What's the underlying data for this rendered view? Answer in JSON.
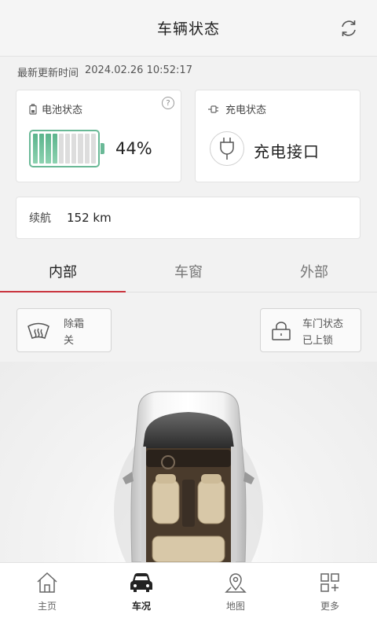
{
  "header": {
    "title": "车辆状态"
  },
  "update": {
    "label": "最新更新时间",
    "time": "2024.02.26 10:52:17"
  },
  "battery": {
    "title": "电池状态",
    "help": "?",
    "percent_text": "44%",
    "level": 0.44
  },
  "charge": {
    "title": "充电状态",
    "status": "充电接口"
  },
  "range": {
    "label": "续航",
    "value": "152 km"
  },
  "tabs": [
    {
      "label": "内部",
      "active": true
    },
    {
      "label": "车窗",
      "active": false
    },
    {
      "label": "外部",
      "active": false
    }
  ],
  "defrost": {
    "label": "除霜",
    "value": "关"
  },
  "door": {
    "label": "车门状态",
    "value": "已上锁"
  },
  "nav": [
    {
      "label": "主页",
      "icon": "home-icon"
    },
    {
      "label": "车况",
      "icon": "car-icon"
    },
    {
      "label": "地图",
      "icon": "map-pin-icon"
    },
    {
      "label": "更多",
      "icon": "grid-plus-icon"
    }
  ],
  "colors": {
    "accent": "#c9343d",
    "battery": "#6ab997"
  }
}
